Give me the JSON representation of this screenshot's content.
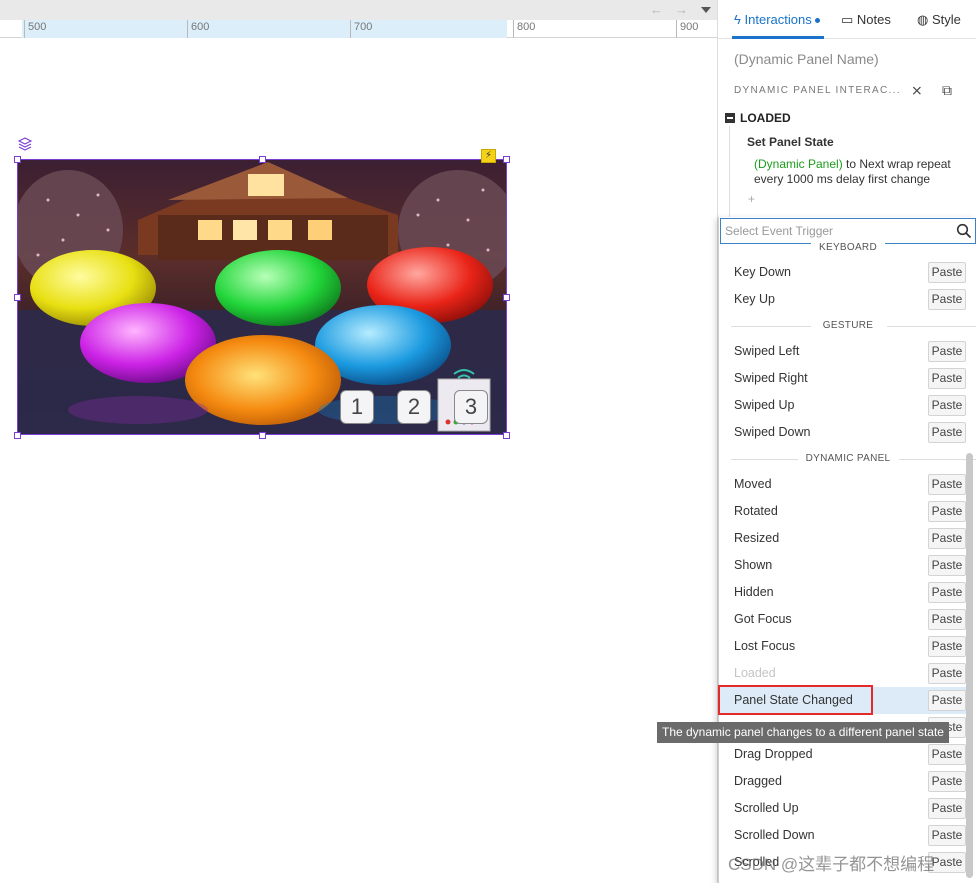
{
  "toolbar": {
    "back_icon": "arrow-left-icon",
    "forward_icon": "arrow-right-icon",
    "menu_icon": "caret-down-icon"
  },
  "ruler": {
    "labels": [
      "500",
      "600",
      "700",
      "800",
      "900"
    ]
  },
  "canvas": {
    "widget_number_buttons": [
      "1",
      "2",
      "3"
    ]
  },
  "right_panel": {
    "tabs": {
      "interactions": "Interactions",
      "notes": "Notes",
      "style": "Style"
    },
    "widget_name_placeholder": "(Dynamic Panel Name)",
    "section_title": "DYNAMIC PANEL INTERAC...",
    "event": {
      "name": "LOADED",
      "action_title": "Set Panel State",
      "action_target": "(Dynamic Panel)",
      "action_desc_line1": " to Next wrap repeat",
      "action_desc_line2": "every 1000 ms delay first change",
      "add_symbol": "+"
    }
  },
  "event_trigger_dropdown": {
    "search_placeholder": "Select Event Trigger",
    "paste_label": "Paste",
    "partial_group": "KEYBOARD",
    "keyboard": [
      "Key Down",
      "Key Up"
    ],
    "gesture_title": "GESTURE",
    "gesture": [
      "Swiped Left",
      "Swiped Right",
      "Swiped Up",
      "Swiped Down"
    ],
    "dynamic_panel_title": "DYNAMIC PANEL",
    "dynamic_panel": [
      "Moved",
      "Rotated",
      "Resized",
      "Shown",
      "Hidden",
      "Got Focus",
      "Lost Focus",
      "Loaded",
      "Panel State Changed"
    ],
    "more": [
      "Drag Dropped",
      "Dragged",
      "Scrolled Up",
      "Scrolled Down",
      "Scrolled"
    ],
    "disabled_item": "Loaded",
    "highlighted_item": "Panel State Changed",
    "tooltip": "The dynamic panel changes to a different panel state"
  },
  "watermark": "CSDN @这辈子都不想编程",
  "colors": {
    "accent": "#1a73c9",
    "selection": "#7a3fd0",
    "highlight_border": "#e52a2a",
    "target_green": "#1d9b1d"
  }
}
